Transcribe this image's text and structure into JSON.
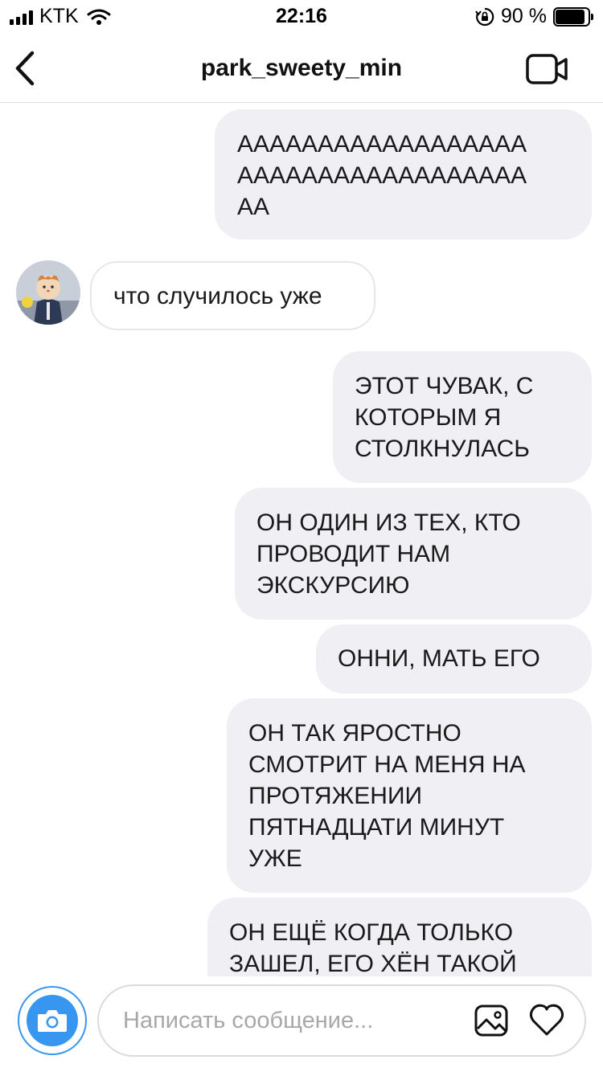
{
  "status_bar": {
    "carrier": "KTK",
    "time": "22:16",
    "battery_percent_label": "90 %",
    "battery_level": 0.9
  },
  "header": {
    "title": "park_sweety_min",
    "back_icon": "chevron-left-icon",
    "video_icon": "video-camera-icon"
  },
  "messages": [
    {
      "direction": "out",
      "text": "АААААААААААААААААА\nАААААААААААААААААА\nАА"
    },
    {
      "direction": "in",
      "text": "что случилось уже"
    },
    {
      "direction": "out",
      "text": "ЭТОТ ЧУВАК, С\nКОТОРЫМ Я\nСТОЛКНУЛАСЬ"
    },
    {
      "direction": "out",
      "text": "ОН ОДИН ИЗ ТЕХ, КТО\nПРОВОДИТ НАМ\nЭКСКУРСИЮ"
    },
    {
      "direction": "out",
      "text": "ОННИ, МАТЬ ЕГО"
    },
    {
      "direction": "out",
      "text": "ОН ТАК ЯРОСТНО\nСМОТРИТ НА МЕНЯ НА\nПРОТЯЖЕНИИ\nПЯТНАДЦАТИ МИНУТ\nУЖЕ"
    },
    {
      "direction": "out",
      "text": "ОН ЕЩЁ КОГДА ТОЛЬКО\nЗАШЕЛ, ЕГО ХЁН ТАКОЙ"
    }
  ],
  "composer": {
    "placeholder": "Написать сообщение...",
    "value": "",
    "camera_icon": "camera-icon",
    "gallery_icon": "image-gallery-icon",
    "like_icon": "heart-icon"
  },
  "colors": {
    "accent": "#3797f0",
    "outgoing_bubble": "#efeff4",
    "incoming_border": "#e7e7e7"
  }
}
